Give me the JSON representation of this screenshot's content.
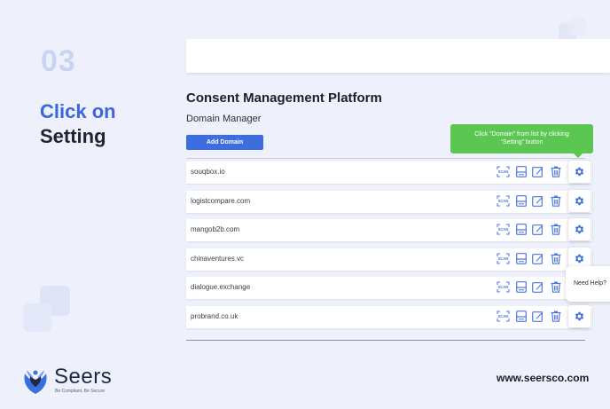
{
  "step": {
    "number": "03",
    "title_line1": "Click on",
    "title_line2": "Setting"
  },
  "app": {
    "platform_title": "Consent Management Platform",
    "section_title": "Domain Manager",
    "add_button": "Add Domain",
    "domains": [
      {
        "name": "souqbox.io"
      },
      {
        "name": "logistcompare.com"
      },
      {
        "name": "mangob2b.com"
      },
      {
        "name": "chinaventures.vc"
      },
      {
        "name": "dialogue.exchange"
      },
      {
        "name": "probrand.co.uk"
      }
    ],
    "row_actions": [
      "scan-icon",
      "save-icon",
      "edit-icon",
      "delete-icon",
      "gear-icon"
    ],
    "scan_label": "SCAN"
  },
  "tooltip": {
    "line1": "Click “Domain” from list by clicking",
    "line2": "“Setting” button"
  },
  "help": {
    "label": "Need Help?"
  },
  "brand": {
    "name": "Seers",
    "tagline": "Be Compliant, Be Secure",
    "website": "www.seersco.com"
  },
  "colors": {
    "accent": "#3d6ddf",
    "tooltip": "#5cc653",
    "background": "#eef1fb",
    "step_number": "#c9d4f5"
  }
}
